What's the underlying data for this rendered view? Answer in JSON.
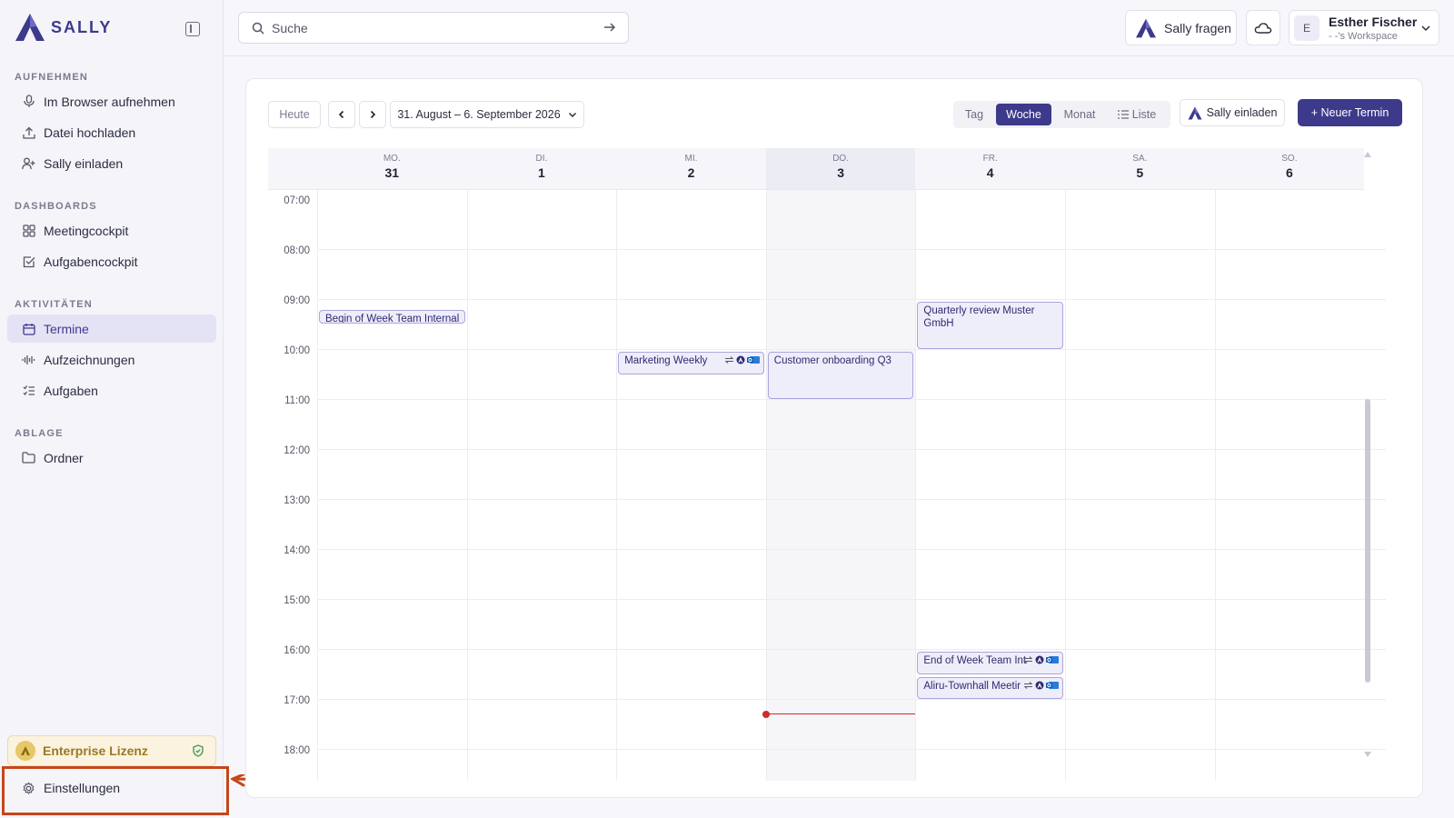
{
  "app": {
    "logo_text": "SALLY"
  },
  "sidebar": {
    "sections": [
      {
        "title": "AUFNEHMEN",
        "items": [
          {
            "label": "Im Browser aufnehmen",
            "icon": "microphone-icon"
          },
          {
            "label": "Datei hochladen",
            "icon": "upload-icon"
          },
          {
            "label": "Sally einladen",
            "icon": "user-plus-icon"
          }
        ]
      },
      {
        "title": "DASHBOARDS",
        "items": [
          {
            "label": "Meetingcockpit",
            "icon": "grid-icon"
          },
          {
            "label": "Aufgabencockpit",
            "icon": "checkbox-icon"
          }
        ]
      },
      {
        "title": "AKTIVITÄTEN",
        "items": [
          {
            "label": "Termine",
            "icon": "calendar-icon",
            "active": true
          },
          {
            "label": "Aufzeichnungen",
            "icon": "waveform-icon"
          },
          {
            "label": "Aufgaben",
            "icon": "task-list-icon"
          }
        ]
      },
      {
        "title": "ABLAGE",
        "items": [
          {
            "label": "Ordner",
            "icon": "folder-icon"
          }
        ]
      }
    ],
    "license": "Enterprise Lizenz",
    "settings": "Einstellungen"
  },
  "topbar": {
    "search_placeholder": "Suche",
    "ask_label": "Sally fragen",
    "user": {
      "initial": "E",
      "name": "Esther Fischer",
      "workspace": "- -'s Workspace"
    }
  },
  "toolbar": {
    "today": "Heute",
    "range": "31. August – 6. September 2026",
    "views": [
      "Tag",
      "Woche",
      "Monat",
      "Liste"
    ],
    "active_view": "Woche",
    "invite": "Sally einladen",
    "new_event": "+ Neuer Termin"
  },
  "calendar": {
    "days": [
      {
        "name": "MO.",
        "date": "31"
      },
      {
        "name": "DI.",
        "date": "1"
      },
      {
        "name": "MI.",
        "date": "2"
      },
      {
        "name": "DO.",
        "date": "3",
        "today": true
      },
      {
        "name": "FR.",
        "date": "4"
      },
      {
        "name": "SA.",
        "date": "5"
      },
      {
        "name": "SO.",
        "date": "6"
      }
    ],
    "hours": [
      "07:00",
      "08:00",
      "09:00",
      "10:00",
      "11:00",
      "12:00",
      "13:00",
      "14:00",
      "15:00",
      "16:00",
      "17:00",
      "18:00"
    ],
    "events": [
      {
        "title": "Begin of Week Team Internal",
        "day": 0,
        "start": 9.17,
        "end": 9.5
      },
      {
        "title": "Quarterly review Muster GmbH",
        "day": 4,
        "start": 9.0,
        "end": 10.0
      },
      {
        "title": "Marketing Weekly",
        "day": 2,
        "start": 10.0,
        "end": 10.5,
        "icons": true
      },
      {
        "title": "Customer onboarding Q3",
        "day": 3,
        "start": 10.0,
        "end": 11.0
      },
      {
        "title": "End of Week Team Int",
        "day": 4,
        "start": 16.0,
        "end": 16.5,
        "icons": true
      },
      {
        "title": "Aliru-Townhall Meetir",
        "day": 4,
        "start": 16.5,
        "end": 17.0,
        "icons": true
      }
    ],
    "now": {
      "day": 3,
      "time": 17.25
    }
  }
}
